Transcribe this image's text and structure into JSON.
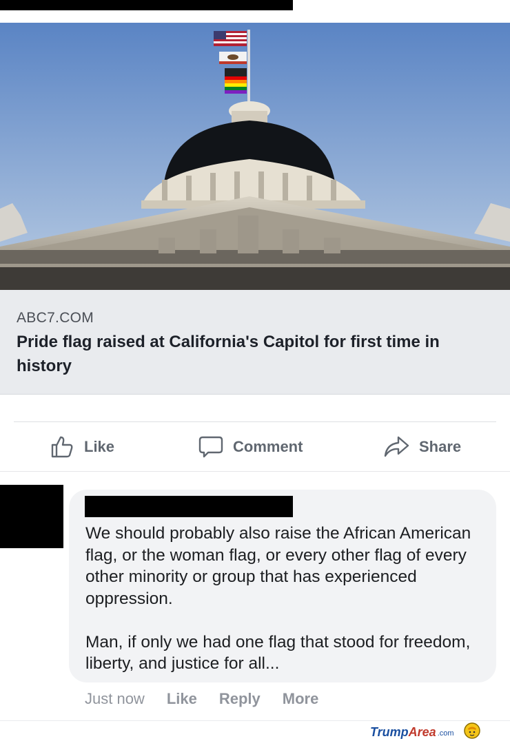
{
  "link_preview": {
    "domain": "ABC7.COM",
    "title": "Pride flag raised at California's Capitol for first time in history"
  },
  "actions": {
    "like_label": "Like",
    "comment_label": "Comment",
    "share_label": "Share"
  },
  "comment": {
    "text": "We should probably also raise the African American flag, or the woman flag, or every other flag of every other minority or group that has experienced oppression.\n\nMan, if only we had one flag that stood for freedom, liberty, and justice for all...",
    "timestamp": "Just now",
    "like_label": "Like",
    "reply_label": "Reply",
    "more_label": "More"
  },
  "watermark": {
    "part1": "Trump",
    "part2": "Area",
    "part3": ".com"
  },
  "colors": {
    "sky_top": "#5a84c4",
    "sky_bottom": "#b9cce3",
    "card_bg": "#e9ebee",
    "action_gray": "#606770",
    "bubble_bg": "#f2f3f5"
  }
}
